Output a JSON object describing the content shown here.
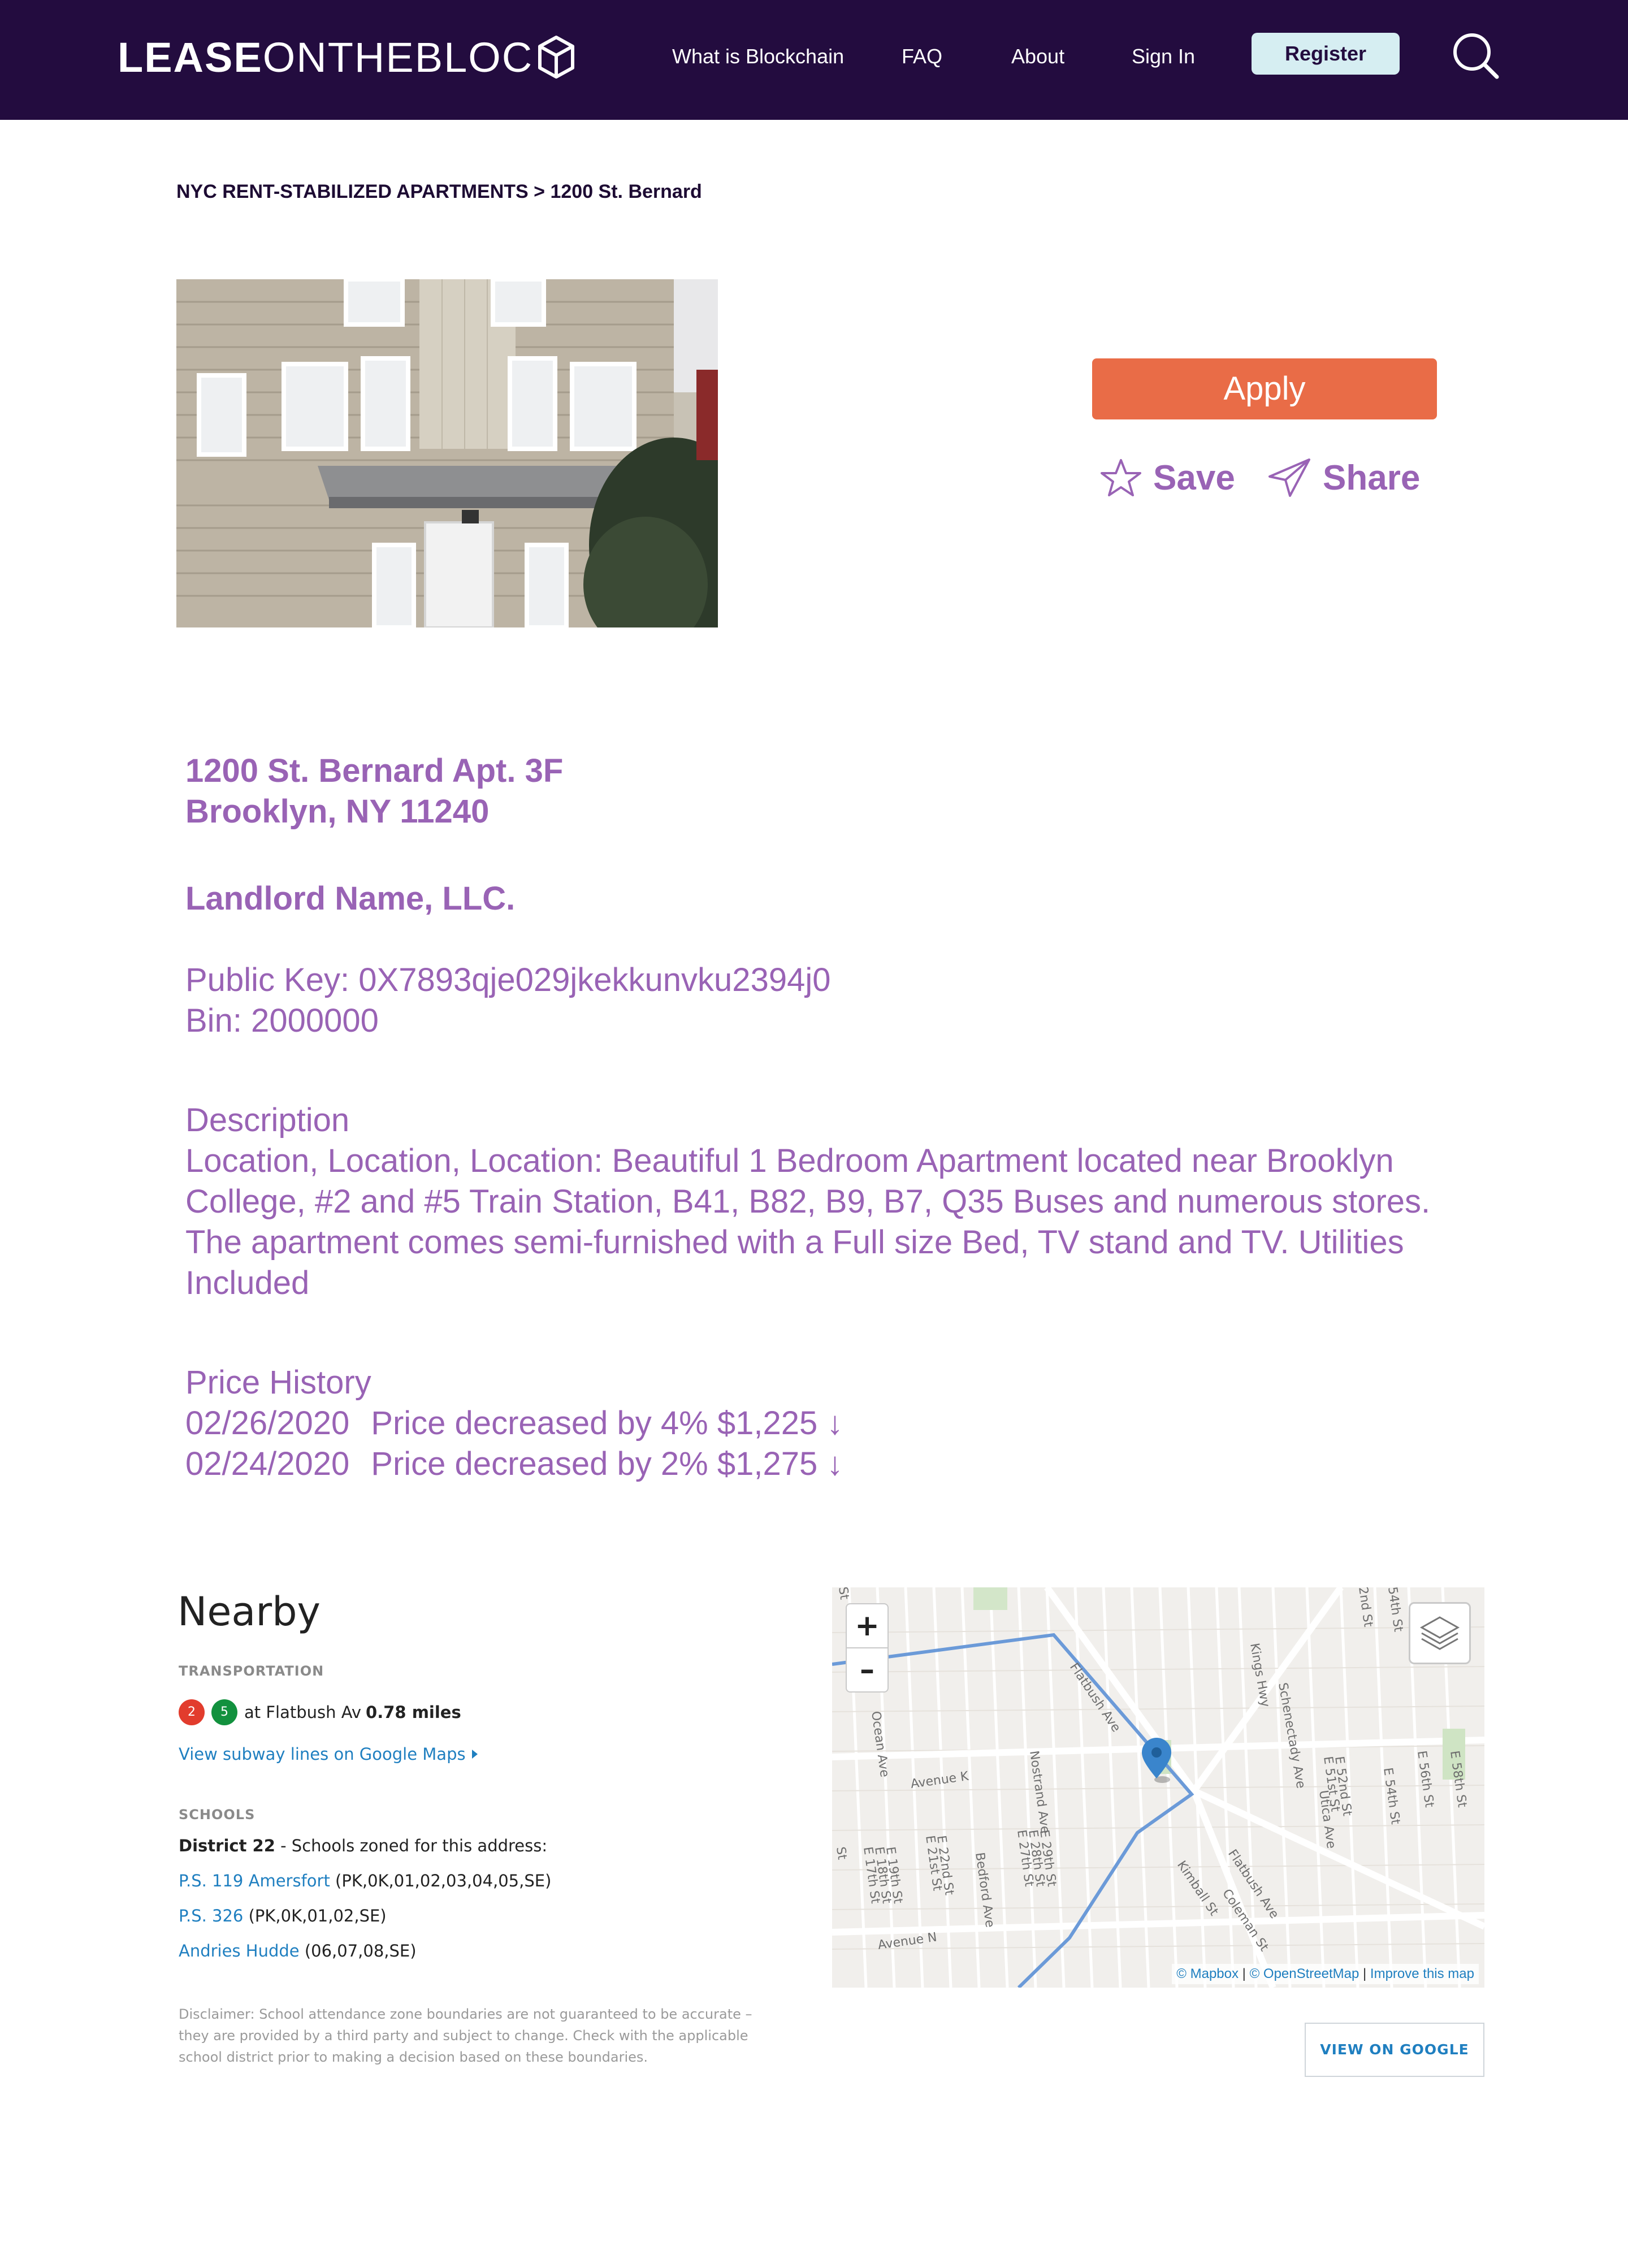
{
  "header": {
    "logo_part1": "LEASE",
    "logo_part2": "ONTHEBLOC",
    "nav": [
      "What is Blockchain",
      "FAQ",
      "About",
      "Sign In"
    ],
    "register_label": "Register",
    "search_icon": "search-icon",
    "background_color": "#230c3f"
  },
  "breadcrumb": {
    "section": "NYC RENT-STABILIZED APARTMENTS",
    "separator": ">",
    "current": "1200 St. Bernard"
  },
  "actions": {
    "apply_label": "Apply",
    "save_label": "Save",
    "share_label": "Share",
    "save_icon": "star-icon",
    "share_icon": "paper-plane-icon",
    "apply_color": "#e96c47",
    "text_color": "#9963b5"
  },
  "listing": {
    "address_line1": "1200 St. Bernard Apt. 3F",
    "address_line2": "Brooklyn, NY 11240",
    "landlord": "Landlord Name, LLC.",
    "public_key": "Public Key: 0X7893qje029jkekkunvku2394j0",
    "bin": "Bin: 2000000",
    "description_heading": "Description",
    "description_text": "Location, Location, Location: Beautiful 1 Bedroom Apartment located near Brooklyn College, #2 and #5 Train Station, B41, B82, B9, B7, Q35 Buses and numerous stores. The apartment comes semi-furnished with a Full size Bed, TV stand and TV. Utilities Included",
    "price_history_heading": "Price History",
    "price_history": [
      {
        "date": "02/26/2020",
        "change": "Price decreased by 4% $1,225 ↓"
      },
      {
        "date": "02/24/2020",
        "change": "Price decreased by 2% $1,275 ↓"
      }
    ]
  },
  "nearby": {
    "title": "Nearby",
    "transportation_label": "TRANSPORTATION",
    "lines": [
      {
        "label": "2",
        "color": "#e23c2d"
      },
      {
        "label": "5",
        "color": "#12913e"
      }
    ],
    "station_text": "at Flatbush Av",
    "distance": "0.78 miles",
    "subway_link": "View subway lines on Google Maps",
    "schools_label": "SCHOOLS",
    "district": "District 22",
    "district_note": "- Schools zoned for this address:",
    "schools": [
      {
        "name": "P.S. 119 Amersfort",
        "grades": "(PK,0K,01,02,03,04,05,SE)"
      },
      {
        "name": "P.S. 326",
        "grades": "(PK,0K,01,02,SE)"
      },
      {
        "name": "Andries Hudde",
        "grades": "(06,07,08,SE)"
      }
    ],
    "disclaimer": "Disclaimer: School attendance zone boundaries are not guaranteed to be accurate – they are provided by a third party and subject to change. Check with the applicable school district prior to making a decision based on these boundaries.",
    "view_google_label": "VIEW ON GOOGLE"
  },
  "map": {
    "zoom_in": "+",
    "zoom_out": "–",
    "attribution": [
      "© Mapbox",
      "© OpenStreetMap",
      "Improve this map"
    ],
    "attribution_sep": "|",
    "street_labels": [
      "Flatbush Ave",
      "Kings Hwy",
      "Schenectady Ave",
      "Ocean Ave",
      "Avenue K",
      "Nostrand Ave",
      "E 29th St",
      "E 28th St",
      "E 27th St",
      "Bedford Ave",
      "E 22nd St",
      "E 21st St",
      "E 19th St",
      "E 18th St",
      "E 17th St",
      "Avenue N",
      "Kimball St",
      "Coleman St",
      "Flatbush Ave",
      "E 52nd St",
      "E 51st St",
      "Utica Ave",
      "E 54th St",
      "E 56th St",
      "E 58th St",
      "54th St",
      "2nd St",
      "St",
      "St"
    ],
    "marker_icon": "map-pin-icon",
    "layers_icon": "layers-icon"
  }
}
